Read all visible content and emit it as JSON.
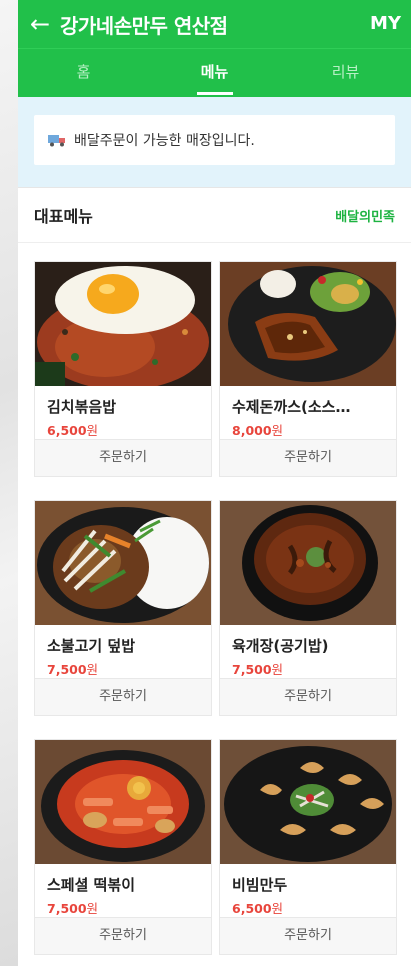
{
  "header": {
    "back_label": "←",
    "title": "강가네손만두 연산점",
    "my_label": "MY"
  },
  "tabs": [
    {
      "label": "홈"
    },
    {
      "label": "메뉴"
    },
    {
      "label": "리뷰"
    }
  ],
  "notice": {
    "text": "배달주문이 가능한 매장입니다."
  },
  "section": {
    "title": "대표메뉴",
    "link_label": "배달의민족"
  },
  "menu": [
    {
      "name": "김치볶음밥",
      "price": "6,500",
      "currency": "원",
      "order_label": "주문하기"
    },
    {
      "name": "수제돈까스(소스…",
      "price": "8,000",
      "currency": "원",
      "order_label": "주문하기"
    },
    {
      "name": "소불고기 덮밥",
      "price": "7,500",
      "currency": "원",
      "order_label": "주문하기"
    },
    {
      "name": "육개장(공기밥)",
      "price": "7,500",
      "currency": "원",
      "order_label": "주문하기"
    },
    {
      "name": "스페셜 떡볶이",
      "price": "7,500",
      "currency": "원",
      "order_label": "주문하기"
    },
    {
      "name": "비빔만두",
      "price": "6,500",
      "currency": "원",
      "order_label": "주문하기"
    }
  ],
  "colors": {
    "brand_green": "#21c04a",
    "notice_bg": "#e2f3fb",
    "price_red": "#e8453c"
  }
}
